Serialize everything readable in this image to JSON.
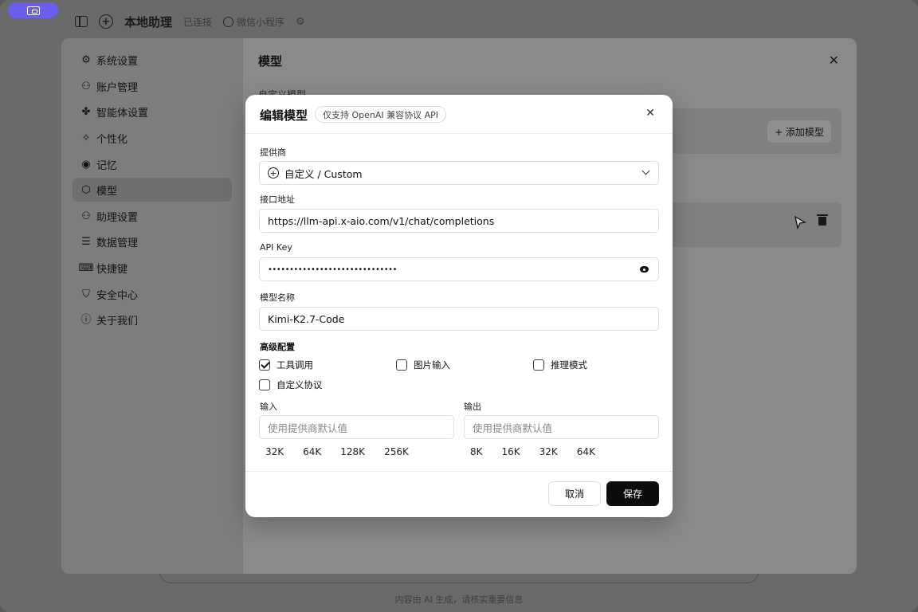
{
  "topbar": {
    "title": "本地助理",
    "status": "已连接",
    "wechat": "微信小程序"
  },
  "footer": {
    "note": "内容由 AI 生成，请核实重要信息"
  },
  "settings": {
    "nav": [
      {
        "label": "系统设置",
        "icon": "gear-icon"
      },
      {
        "label": "账户管理",
        "icon": "user-icon"
      },
      {
        "label": "智能体设置",
        "icon": "puzzle-icon"
      },
      {
        "label": "个性化",
        "icon": "sparkle-icon"
      },
      {
        "label": "记忆",
        "icon": "pin-icon"
      },
      {
        "label": "模型",
        "icon": "cube-icon",
        "active": true
      },
      {
        "label": "助理设置",
        "icon": "user-gear-icon"
      },
      {
        "label": "数据管理",
        "icon": "database-icon"
      },
      {
        "label": "快捷键",
        "icon": "keyboard-icon"
      },
      {
        "label": "安全中心",
        "icon": "shield-icon"
      },
      {
        "label": "关于我们",
        "icon": "info-icon"
      }
    ],
    "main_title": "模型",
    "subheading": "自定义模型",
    "add_model": "+ 添加模型"
  },
  "dialog": {
    "title": "编辑模型",
    "badge": "仅支持 OpenAI 兼容协议 API",
    "provider_label": "提供商",
    "provider_value": "自定义 / Custom",
    "endpoint_label": "接口地址",
    "endpoint_value": "https://llm-api.x-aio.com/v1/chat/completions",
    "apikey_label": "API Key",
    "apikey_value": "••••••••••••••••••••••••••••••",
    "model_name_label": "模型名称",
    "model_name_value": "Kimi-K2.7-Code",
    "advanced_label": "高级配置",
    "options": [
      {
        "label": "工具调用",
        "checked": true
      },
      {
        "label": "图片输入",
        "checked": false
      },
      {
        "label": "推理模式",
        "checked": false
      },
      {
        "label": "自定义协议",
        "checked": false
      }
    ],
    "input_label": "输入",
    "input_placeholder": "使用提供商默认值",
    "input_chips": [
      "32K",
      "64K",
      "128K",
      "256K"
    ],
    "output_label": "输出",
    "output_placeholder": "使用提供商默认值",
    "output_chips": [
      "8K",
      "16K",
      "32K",
      "64K"
    ],
    "cancel": "取消",
    "save": "保存"
  },
  "colors": {
    "save_bg": "#0c0c0c",
    "rec_pill": "#6b5ff0"
  }
}
